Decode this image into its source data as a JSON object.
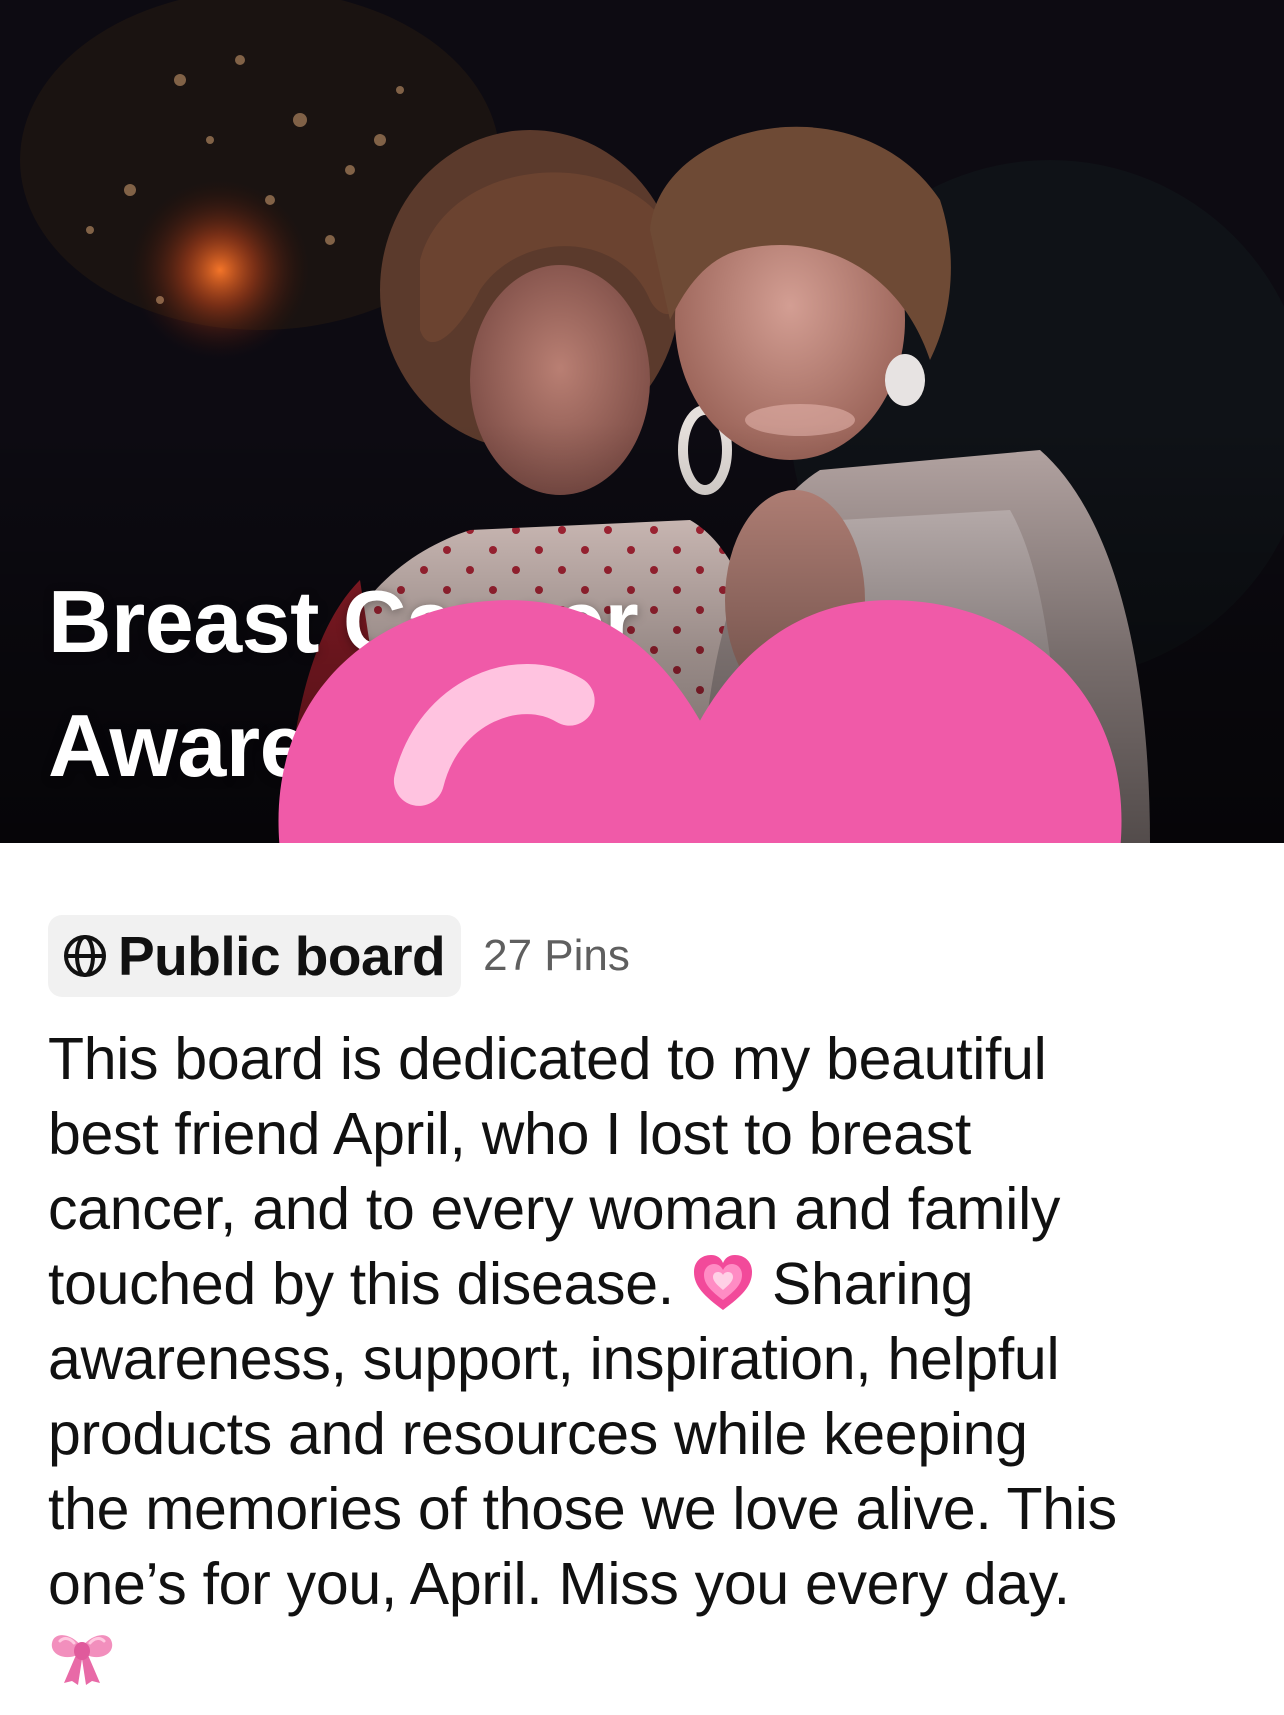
{
  "board": {
    "title_line1": "Breast Cancer",
    "title_line2": "Awareness",
    "visibility": "Public board",
    "pin_count": "27 Pins",
    "description_lines": [
      "This board is dedicated to my beautiful",
      "best friend April, who I lost to breast",
      "cancer, and to every woman and family",
      "touched by this disease.",
      "Sharing",
      "awareness, support, inspiration, helpful",
      "products and resources while keeping",
      "the memories of those we love alive. This",
      "one’s for you, April. Miss you every day."
    ]
  },
  "icons": {
    "title_emoji": "pink-heart-icon",
    "visibility_icon": "globe-icon",
    "inline_emoji": "sparkling-heart-icon",
    "closing_emoji": "pink-ribbon-bow-icon"
  },
  "colors": {
    "title_text": "#ffffff",
    "body_text": "#111111",
    "chip_background": "#f1f1f1",
    "pin_count_text": "#5f5f5f",
    "heart_pink": "#f05aa8"
  }
}
